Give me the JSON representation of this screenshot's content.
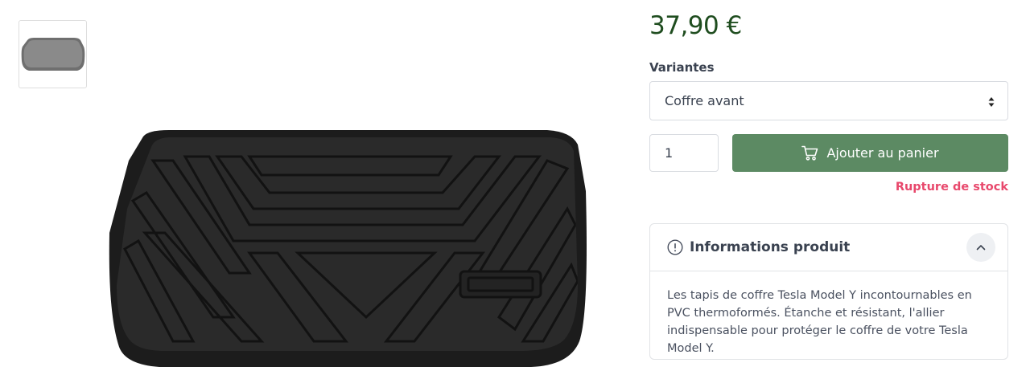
{
  "product": {
    "price": "37,90 €",
    "main_image_alt": "Tapis de coffre Tesla Model Y"
  },
  "variants": {
    "label": "Variantes",
    "selected": "Coffre avant"
  },
  "cart": {
    "quantity": "1",
    "add_button_label": "Ajouter au panier",
    "stock_status": "Rupture de stock",
    "accent_color": "#5c8a63",
    "stock_color": "#e8486c"
  },
  "info": {
    "title": "Informations produit",
    "description": "Les tapis de coffre Tesla Model Y incontournables en PVC thermoformés. Étanche et résistant, l'allier indispensable pour protéger le coffre de votre Tesla Model Y."
  },
  "icons": {
    "cart": "cart-icon",
    "info": "info-circle-icon",
    "collapse": "chevron-up-icon",
    "select_arrows": "sort-arrows-icon"
  }
}
